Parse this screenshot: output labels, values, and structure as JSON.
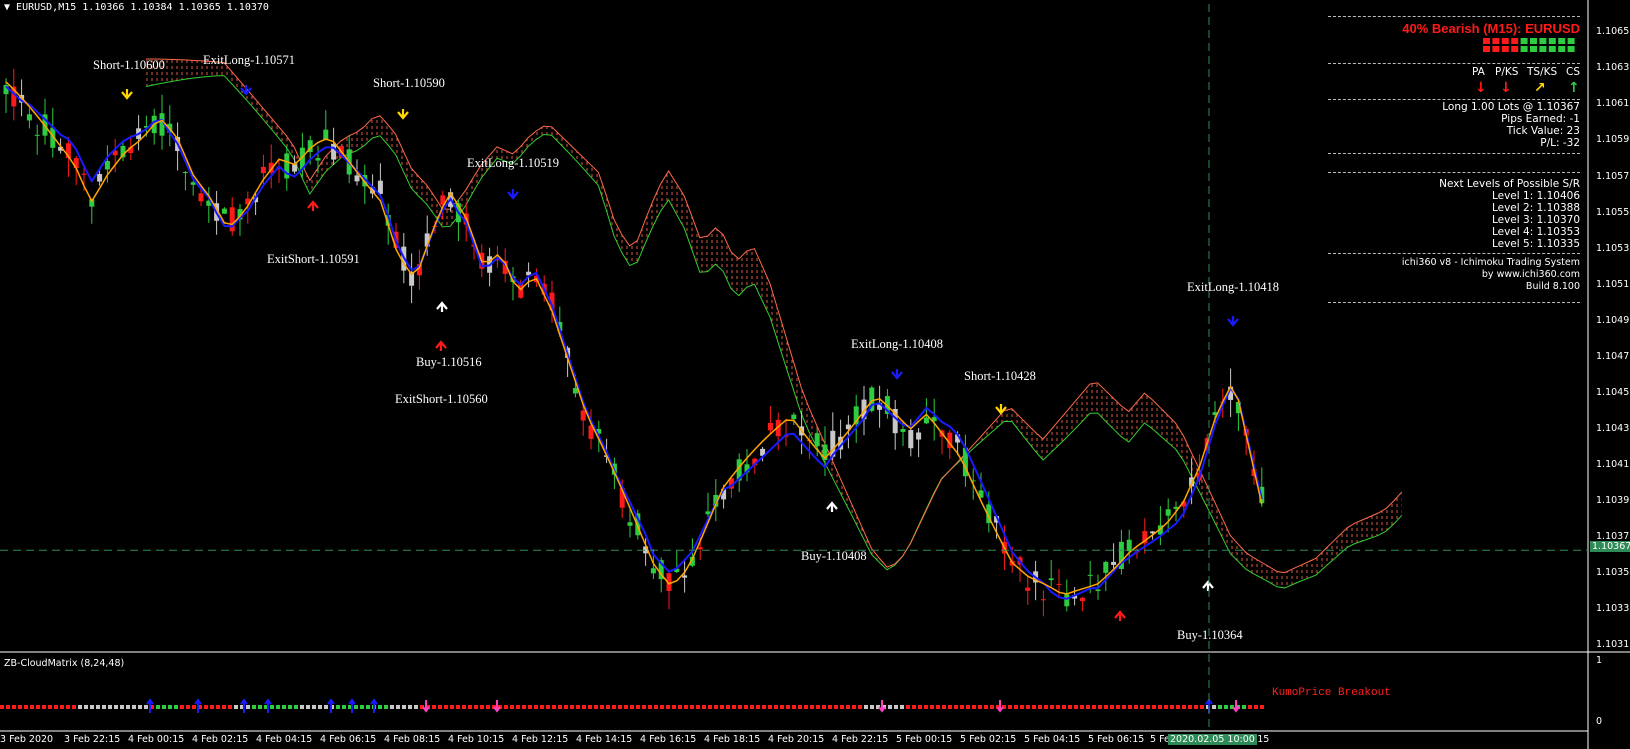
{
  "header": {
    "symbol_info": "EURUSD,M15  1.10366 1.10384 1.10365 1.10370"
  },
  "panel": {
    "bias": "40% Bearish (M15): EURUSD",
    "symbols": [
      "PA",
      "P/KS",
      "TS/KS",
      "CS"
    ],
    "symbol_arrows": [
      {
        "dir": "down",
        "color": "#ff1a1a"
      },
      {
        "dir": "down",
        "color": "#ff1a1a"
      },
      {
        "dir": "up-right",
        "color": "#ffd700"
      },
      {
        "dir": "up",
        "color": "#2ecc40"
      }
    ],
    "position": "Long 1.00 Lots @ 1.10367",
    "pips": "Pips Earned: -1",
    "tick_value": "Tick Value: 23",
    "pl": "P/L: -32",
    "sr_title": "Next Levels of Possible S/R",
    "levels": [
      "Level 1: 1.10406",
      "Level 2: 1.10388",
      "Level 3: 1.10370",
      "Level 4: 1.10353",
      "Level 5: 1.10335"
    ],
    "footer1": "ichi360 v8 - Ichimoku Trading System",
    "footer2": "by www.ichi360.com",
    "footer3": "Build 8.100"
  },
  "signals": [
    {
      "text": "Short-1.10600"
    },
    {
      "text": "ExitLong-1.10571"
    },
    {
      "text": "Short-1.10590"
    },
    {
      "text": "ExitLong-1.10519"
    },
    {
      "text": "ExitShort-1.10591"
    },
    {
      "text": "Buy-1.10516"
    },
    {
      "text": "ExitShort-1.10560"
    },
    {
      "text": "ExitLong-1.10408"
    },
    {
      "text": "Short-1.10428"
    },
    {
      "text": "Buy-1.10408"
    },
    {
      "text": "ExitLong-1.10418"
    },
    {
      "text": "Buy-1.10364"
    }
  ],
  "indicator": {
    "title": "ZB-CloudMatrix (8,24,48)",
    "alert": "KumoPrice Breakout",
    "scale_top": "1",
    "scale_bottom": "0"
  },
  "current_price": "1.10367",
  "crosshair_time": "2020.02.05 10:00",
  "x_labels": [
    "3 Feb 2020",
    "3 Feb 22:15",
    "4 Feb 00:15",
    "4 Feb 02:15",
    "4 Feb 04:15",
    "4 Feb 06:15",
    "4 Feb 08:15",
    "4 Feb 10:15",
    "4 Feb 12:15",
    "4 Feb 14:15",
    "4 Feb 16:15",
    "4 Feb 18:15",
    "4 Feb 20:15",
    "4 Feb 22:15",
    "5 Feb 00:15",
    "5 Feb 02:15",
    "5 Feb 04:15",
    "5 Feb 06:15",
    "5 Fe",
    "0:15"
  ],
  "y_labels": [
    "1.10655",
    "1.10635",
    "1.10615",
    "1.10595",
    "1.10575",
    "1.10555",
    "1.10535",
    "1.10515",
    "1.10495",
    "1.10475",
    "1.10455",
    "1.10435",
    "1.10415",
    "1.10395",
    "1.10375",
    "1.10355",
    "1.10335",
    "1.10315"
  ],
  "colors": {
    "bull": "#2ecc40",
    "bear": "#ff1a1a",
    "neutral": "#c8c8c8",
    "kijun": "#1a1aff",
    "tenkan": "#ffa500",
    "cloud_red": "#ff6a4a",
    "cloud_green": "#32cd32",
    "grid_line": "#2e8b57"
  },
  "chart_data": {
    "type": "candlestick",
    "symbol": "EURUSD",
    "timeframe": "M15",
    "ylim": [
      1.10312,
      1.10665
    ],
    "current_price": 1.10367,
    "close_path": [
      1.1062,
      1.1061,
      1.106,
      1.1059,
      1.1058,
      1.1056,
      1.10575,
      1.10585,
      1.1059,
      1.106,
      1.1059,
      1.1057,
      1.1056,
      1.10545,
      1.10555,
      1.1057,
      1.1058,
      1.10575,
      1.10585,
      1.1059,
      1.1058,
      1.1057,
      1.1056,
      1.1053,
      1.10516,
      1.1054,
      1.1056,
      1.10545,
      1.1052,
      1.1053,
      1.1051,
      1.1052,
      1.105,
      1.1047,
      1.1044,
      1.1042,
      1.104,
      1.1038,
      1.1036,
      1.1035,
      1.1036,
      1.1038,
      1.104,
      1.1041,
      1.1042,
      1.1043,
      1.1044,
      1.1043,
      1.1042,
      1.1043,
      1.1044,
      1.1045,
      1.1044,
      1.1043,
      1.1044,
      1.1043,
      1.1042,
      1.104,
      1.1038,
      1.1036,
      1.1035,
      1.10345,
      1.1034,
      1.10345,
      1.1035,
      1.1036,
      1.1037,
      1.10375,
      1.1038,
      1.1039,
      1.1041,
      1.1044,
      1.1046,
      1.1042,
      1.1038,
      1.1037
    ]
  }
}
